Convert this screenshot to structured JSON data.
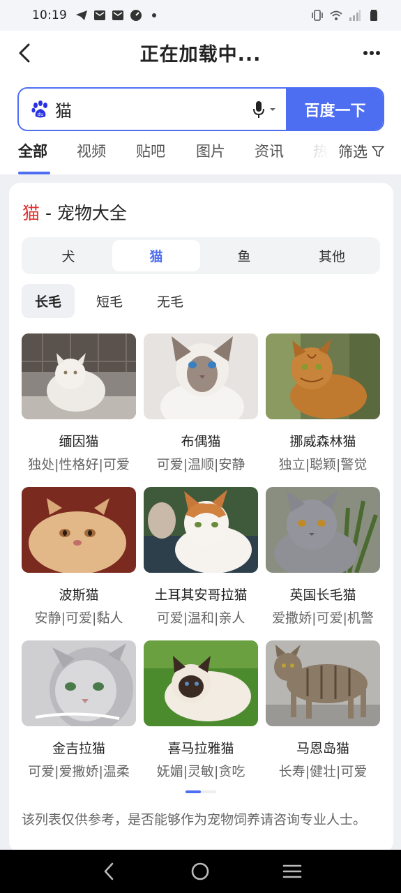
{
  "status_bar": {
    "time": "10:19",
    "icons": [
      "telegram-icon",
      "mail-icon",
      "mail-icon",
      "speed-icon",
      "dot-icon",
      "vibrate-icon",
      "wifi-icon",
      "signal-icon",
      "battery-icon"
    ]
  },
  "title_bar": {
    "title": "正在加载中...",
    "back_icon": "chevron-left-icon",
    "more_icon": "more-icon"
  },
  "search": {
    "query": "猫",
    "button_label": "百度一下",
    "logo_icon": "paw-icon",
    "mic_icon": "mic-icon"
  },
  "tabs": {
    "items": [
      "全部",
      "视频",
      "贴吧",
      "图片",
      "资讯",
      "热"
    ],
    "active": "全部",
    "filter_label": "筛选"
  },
  "card": {
    "keyword": "猫",
    "title_rest": " - 宠物大全",
    "segments": [
      "犬",
      "猫",
      "鱼",
      "其他"
    ],
    "active_segment": "猫",
    "chips": [
      "长毛",
      "短毛",
      "无毛"
    ],
    "active_chip": "长毛",
    "pets": [
      {
        "name": "缅因猫",
        "tags": "独处|性格好|可爱"
      },
      {
        "name": "布偶猫",
        "tags": "可爱|温顺|安静"
      },
      {
        "name": "挪威森林猫",
        "tags": "独立|聪颖|警觉"
      },
      {
        "name": "波斯猫",
        "tags": "安静|可爱|黏人"
      },
      {
        "name": "土耳其安哥拉猫",
        "tags": "可爱|温和|亲人"
      },
      {
        "name": "英国长毛猫",
        "tags": "爱撒娇|可爱|机警"
      },
      {
        "name": "金吉拉猫",
        "tags": "可爱|爱撒娇|温柔"
      },
      {
        "name": "喜马拉雅猫",
        "tags": "妩媚|灵敏|贪吃"
      },
      {
        "name": "马恩岛猫",
        "tags": "长寿|健壮|可爱"
      }
    ],
    "pager": {
      "pages": 2,
      "current": 1
    },
    "disclaimer": "该列表仅供参考，是否能够作为宠物饲养请咨询专业人士。"
  },
  "colors": {
    "accent": "#4e6ef2",
    "keyword_red": "#e0312f"
  }
}
